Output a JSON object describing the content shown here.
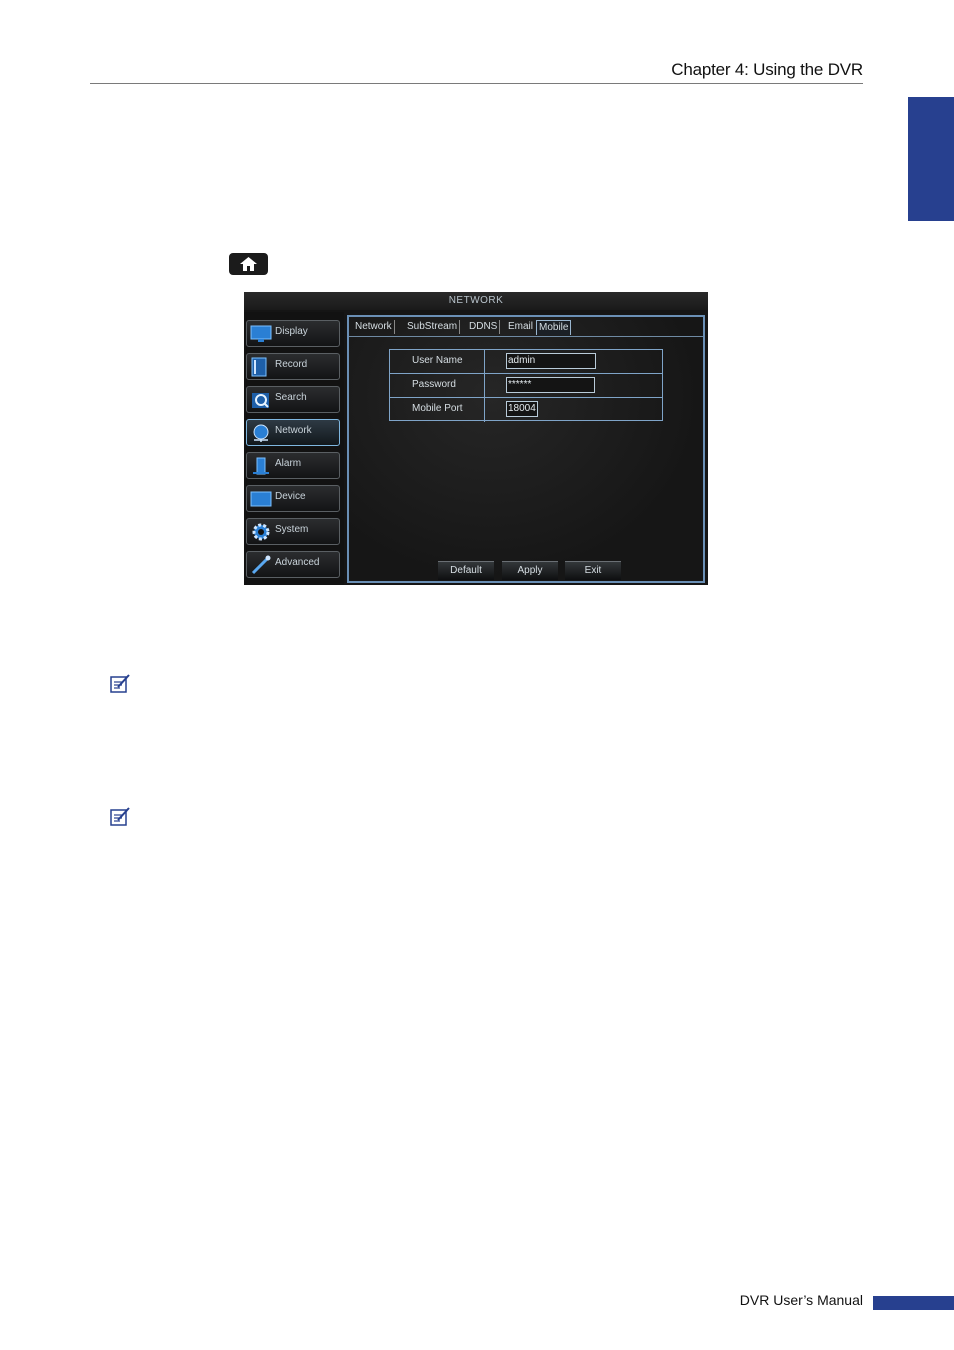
{
  "header": {
    "chapter_title": "Chapter 4: Using the DVR"
  },
  "footer": {
    "manual_title": "DVR User’s Manual"
  },
  "colors": {
    "accent": "#27408f",
    "dvr_highlight": "#6a8fb5"
  },
  "icons": {
    "home": "home-icon",
    "note": "note-pad-icon"
  },
  "dvr": {
    "title": "NETWORK",
    "sidebar": [
      {
        "label": "Display",
        "icon": "monitor-icon"
      },
      {
        "label": "Record",
        "icon": "film-icon"
      },
      {
        "label": "Search",
        "icon": "magnifier-icon"
      },
      {
        "label": "Network",
        "icon": "globe-icon",
        "active": true
      },
      {
        "label": "Alarm",
        "icon": "alarm-icon"
      },
      {
        "label": "Device",
        "icon": "device-icon"
      },
      {
        "label": "System",
        "icon": "gear-icon"
      },
      {
        "label": "Advanced",
        "icon": "wrench-icon"
      }
    ],
    "tabs": [
      {
        "label": "Network"
      },
      {
        "label": "SubStream"
      },
      {
        "label": "DDNS"
      },
      {
        "label": "Email"
      },
      {
        "label": "Mobile",
        "active": true
      }
    ],
    "form": {
      "user_name": {
        "label": "User Name",
        "value": "admin"
      },
      "password": {
        "label": "Password",
        "value": "******"
      },
      "mobile_port": {
        "label": "Mobile Port",
        "value": "18004"
      }
    },
    "buttons": {
      "default": "Default",
      "apply": "Apply",
      "exit": "Exit"
    }
  }
}
